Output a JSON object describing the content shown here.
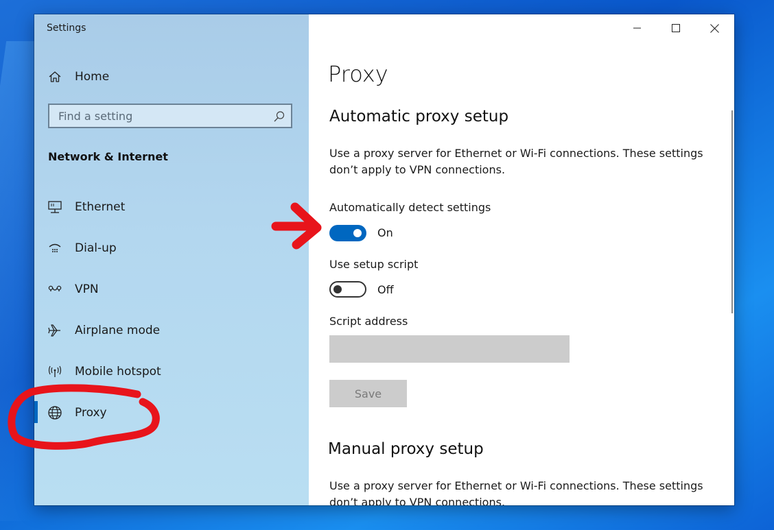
{
  "window": {
    "title": "Settings"
  },
  "sidebar": {
    "home_label": "Home",
    "search": {
      "placeholder": "Find a setting"
    },
    "section_title": "Network & Internet",
    "items": [
      {
        "label": "Ethernet",
        "icon": "ethernet-icon"
      },
      {
        "label": "Dial-up",
        "icon": "dialup-icon"
      },
      {
        "label": "VPN",
        "icon": "vpn-icon"
      },
      {
        "label": "Airplane mode",
        "icon": "airplane-icon"
      },
      {
        "label": "Mobile hotspot",
        "icon": "hotspot-icon"
      },
      {
        "label": "Proxy",
        "icon": "globe-icon",
        "selected": true
      }
    ]
  },
  "main": {
    "title": "Proxy",
    "auto": {
      "heading": "Automatic proxy setup",
      "description": "Use a proxy server for Ethernet or Wi-Fi connections. These settings don’t apply to VPN connections.",
      "detect_label": "Automatically detect settings",
      "detect_state": "On",
      "script_label": "Use setup script",
      "script_state": "Off",
      "address_label": "Script address",
      "address_value": "",
      "save_label": "Save"
    },
    "manual": {
      "heading": "Manual proxy setup",
      "description": "Use a proxy server for Ethernet or Wi-Fi connections. These settings don’t apply to VPN connections."
    }
  },
  "colors": {
    "accent": "#0067c0",
    "annotation": "#e8141b"
  }
}
